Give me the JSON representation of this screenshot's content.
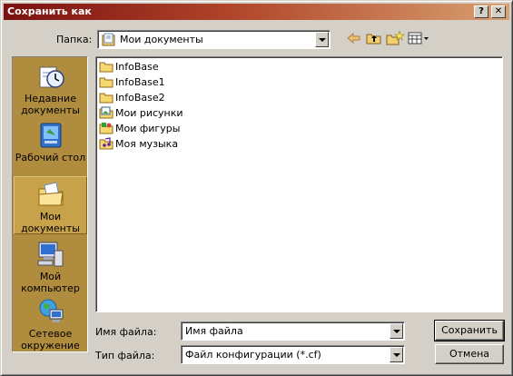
{
  "window": {
    "title": "Сохранить как",
    "help_label": "?",
    "close_label": "✕"
  },
  "folder": {
    "label": "Папка:",
    "value": "Мои документы"
  },
  "toolbar": {
    "icons": [
      "back-arrow-icon",
      "up-folder-icon",
      "new-folder-icon",
      "view-menu-icon"
    ]
  },
  "places": [
    {
      "label": "Недавние документы",
      "icon": "recent-documents-icon"
    },
    {
      "label": "Рабочий стол",
      "icon": "desktop-icon"
    },
    {
      "label": "Мои документы",
      "icon": "my-documents-icon",
      "selected": true
    },
    {
      "label": "Мой компьютер",
      "icon": "my-computer-icon"
    },
    {
      "label": "Сетевое окружение",
      "icon": "network-icon"
    }
  ],
  "files": [
    {
      "name": "InfoBase",
      "icon": "folder-icon"
    },
    {
      "name": "InfoBase1",
      "icon": "folder-icon"
    },
    {
      "name": "InfoBase2",
      "icon": "folder-icon"
    },
    {
      "name": "Мои рисунки",
      "icon": "pictures-folder-icon"
    },
    {
      "name": "Мои фигуры",
      "icon": "shapes-folder-icon"
    },
    {
      "name": "Моя музыка",
      "icon": "music-folder-icon"
    }
  ],
  "filename": {
    "label": "Имя файла:",
    "value": "Имя файла"
  },
  "filetype": {
    "label": "Тип файла:",
    "value": "Файл конфигурации (*.cf)"
  },
  "buttons": {
    "save": "Сохранить",
    "cancel": "Отмена"
  },
  "colors": {
    "title_start": "#7a1010",
    "title_end": "#d9a070",
    "places_bg": "#b08c3e",
    "face": "#d4d0c8"
  }
}
